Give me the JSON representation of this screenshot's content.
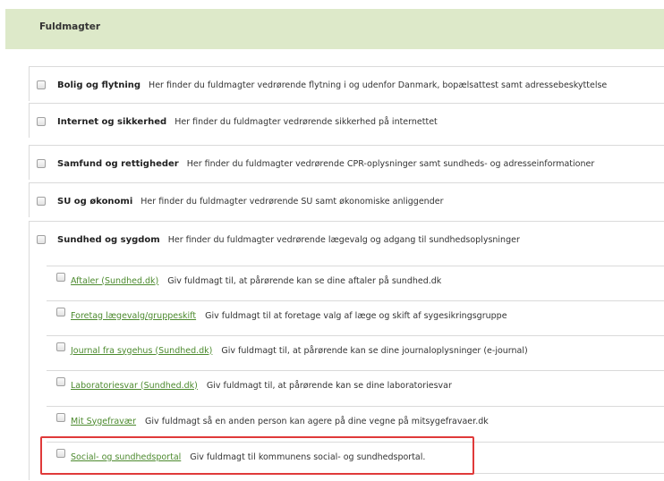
{
  "header": {
    "title": "Fuldmagter"
  },
  "categories": [
    {
      "name": "Bolig og flytning",
      "description": "Her finder du fuldmagter vedrørende flytning i og udenfor Danmark, bopælsattest samt adressebeskyttelse"
    },
    {
      "name": "Internet og sikkerhed",
      "description": "Her finder du fuldmagter vedrørende sikkerhed på internettet"
    },
    {
      "name": "Samfund og rettigheder",
      "description": "Her finder du fuldmagter vedrørende CPR-oplysninger samt sundheds- og adresseinformationer"
    },
    {
      "name": "SU og økonomi",
      "description": "Her finder du fuldmagter vedrørende SU samt økonomiske anliggender"
    },
    {
      "name": "Sundhed og sygdom",
      "description": "Her finder du fuldmagter vedrørende lægevalg og adgang til sundhedsoplysninger"
    }
  ],
  "sub_items": [
    {
      "link": "Aftaler (Sundhed.dk)",
      "description": "Giv fuldmagt til, at pårørende kan se dine aftaler på sundhed.dk"
    },
    {
      "link": "Foretag lægevalg/gruppeskift",
      "description": "Giv fuldmagt til at foretage valg af læge og skift af sygesikringsgruppe"
    },
    {
      "link": "Journal fra sygehus (Sundhed.dk)",
      "description": "Giv fuldmagt til, at pårørende kan se dine journaloplysninger (e-journal)"
    },
    {
      "link": "Laboratoriesvar (Sundhed.dk)",
      "description": "Giv fuldmagt til, at pårørende kan se dine laboratoriesvar"
    },
    {
      "link": "Mit Sygefravær",
      "description": "Giv fuldmagt så en anden person kan agere på dine vegne på mitsygefravaer.dk"
    },
    {
      "link": "Social- og sundhedsportal",
      "description": "Giv fuldmagt til kommunens social- og sundhedsportal."
    }
  ],
  "colors": {
    "header_bg": "#dde9c9",
    "link": "#4c8a2e",
    "highlight": "#e03a3a",
    "border": "#dadada"
  }
}
